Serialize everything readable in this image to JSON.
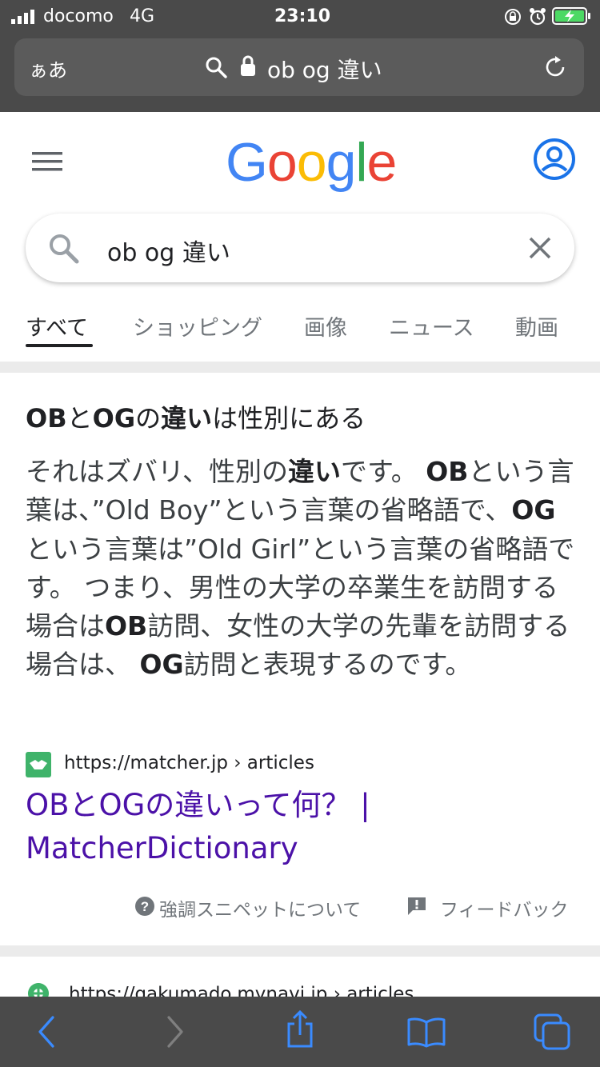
{
  "status_bar": {
    "carrier": "docomo",
    "network": "4G",
    "time": "23:10"
  },
  "safari": {
    "text_size_label": "ぁあ",
    "url_text": "ob og 違い"
  },
  "google": {
    "logo_letters": [
      "G",
      "o",
      "o",
      "g",
      "l",
      "e"
    ],
    "logo_colors": [
      "#4285F4",
      "#EA4335",
      "#FBBC05",
      "#4285F4",
      "#34A853",
      "#EA4335"
    ],
    "search_query": "ob og 違い",
    "tabs": [
      {
        "label": "すべて"
      },
      {
        "label": "ショッピング"
      },
      {
        "label": "画像"
      },
      {
        "label": "ニュース"
      },
      {
        "label": "動画"
      }
    ]
  },
  "snippet": {
    "title_parts": [
      "OB",
      "と",
      "OG",
      "の",
      "違い",
      "は性別にある"
    ],
    "body_parts": [
      "それはズバリ、性別の",
      "違い",
      "です。 ",
      "OB",
      "という言葉は、”Old Boy”という言葉の省略語で、",
      "OG",
      "という言葉は”Old Girl”という言葉の省略語です。 つまり、男性の大学の卒業生を訪問する場合は",
      "OB",
      "訪問、女性の大学の先輩を訪問する場合は、 ",
      "OG",
      "訪問と表現するのです。"
    ],
    "source_url": "https://matcher.jp › articles",
    "link_title": "OBとOGの違いって何？ | MatcherDictionary",
    "about_label": "強調スニペットについて",
    "feedback_label": "フィードバック"
  },
  "next_result": {
    "source_url": "https://gakumado.mynavi.jp › articles"
  },
  "colors": {
    "link_visited": "#4b11a8",
    "accent_blue": "#1a73e8",
    "safari_chrome": "#4a4a4a"
  }
}
